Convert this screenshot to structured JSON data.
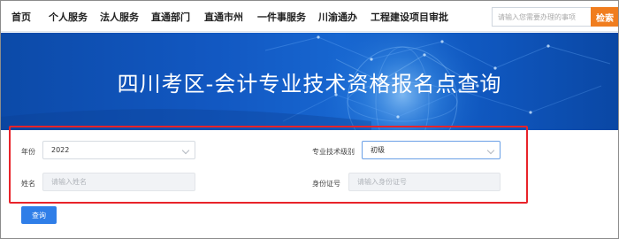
{
  "nav": {
    "items": [
      {
        "label": "首页"
      },
      {
        "label": "个人服务"
      },
      {
        "label": "法人服务"
      },
      {
        "label": "直通部门"
      },
      {
        "label": "直通市州"
      },
      {
        "label": "一件事服务"
      },
      {
        "label": "川渝通办"
      },
      {
        "label": "工程建设项目审批"
      }
    ],
    "search_placeholder": "请输入您需要办理的事项",
    "search_button": "检索"
  },
  "banner": {
    "title": "四川考区-会计专业技术资格报名点查询"
  },
  "form": {
    "year": {
      "label": "年份",
      "value": "2022"
    },
    "level": {
      "label": "专业技术级别",
      "value": "初级"
    },
    "name": {
      "label": "姓名",
      "placeholder": "请输入姓名"
    },
    "id_number": {
      "label": "身份证号",
      "placeholder": "请输入身份证号"
    },
    "submit_label": "查询"
  },
  "colors": {
    "accent_orange": "#f07d1e",
    "banner_blue": "#1258c2",
    "highlight_red": "#e8232a",
    "button_blue": "#2f7ee8"
  }
}
